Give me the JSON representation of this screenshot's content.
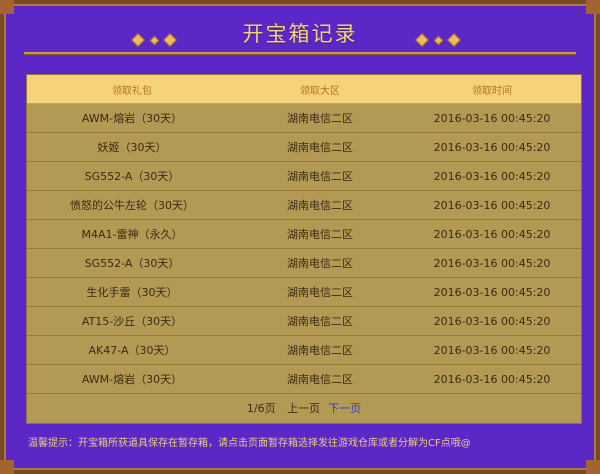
{
  "header": {
    "title": "开宝箱记录"
  },
  "table": {
    "columns": [
      "领取礼包",
      "领取大区",
      "领取时间"
    ],
    "rows": [
      [
        "AWM-熔岩（30天）",
        "湖南电信二区",
        "2016-03-16 00:45:20"
      ],
      [
        "妖姬（30天）",
        "湖南电信二区",
        "2016-03-16 00:45:20"
      ],
      [
        "SG552-A（30天）",
        "湖南电信二区",
        "2016-03-16 00:45:20"
      ],
      [
        "愤怒的公牛左轮（30天）",
        "湖南电信二区",
        "2016-03-16 00:45:20"
      ],
      [
        "M4A1-雷神（永久）",
        "湖南电信二区",
        "2016-03-16 00:45:20"
      ],
      [
        "SG552-A（30天）",
        "湖南电信二区",
        "2016-03-16 00:45:20"
      ],
      [
        "生化手雷（30天）",
        "湖南电信二区",
        "2016-03-16 00:45:20"
      ],
      [
        "AT15-沙丘（30天）",
        "湖南电信二区",
        "2016-03-16 00:45:20"
      ],
      [
        "AK47-A（30天）",
        "湖南电信二区",
        "2016-03-16 00:45:20"
      ],
      [
        "AWM-熔岩（30天）",
        "湖南电信二区",
        "2016-03-16 00:45:20"
      ]
    ]
  },
  "pager": {
    "page_info": "1/6页",
    "prev_label": "上一页",
    "next_label": "下一页"
  },
  "footer": {
    "note": "温馨提示：开宝箱所获道具保存在暂存箱，请点击页面暂存箱选择发往游戏仓库或者分解为CF点哦@"
  },
  "colors": {
    "background": "#5b28c7",
    "title": "#f3d27a",
    "header_row": "#f6d378",
    "body_row": "#b39a54",
    "link": "#2a3fd6"
  }
}
